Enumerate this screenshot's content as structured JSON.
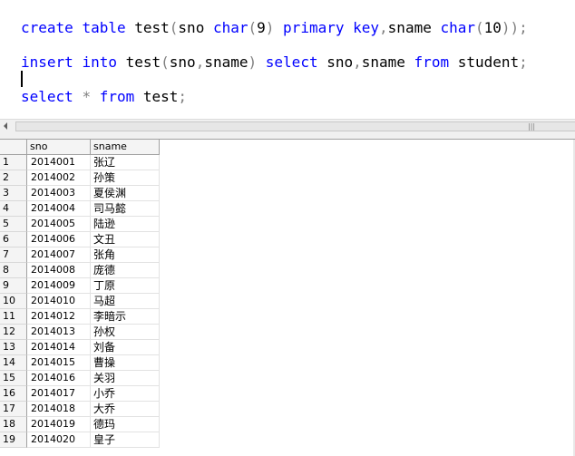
{
  "editor": {
    "line1": [
      {
        "t": "create",
        "k": "kw"
      },
      {
        "t": " ",
        "k": ""
      },
      {
        "t": "table",
        "k": "kw"
      },
      {
        "t": " test",
        "k": ""
      },
      {
        "t": "(",
        "k": "op"
      },
      {
        "t": "sno ",
        "k": ""
      },
      {
        "t": "char",
        "k": "kw"
      },
      {
        "t": "(",
        "k": "op"
      },
      {
        "t": "9",
        "k": ""
      },
      {
        "t": ")",
        "k": "op"
      },
      {
        "t": " ",
        "k": ""
      },
      {
        "t": "primary",
        "k": "kw"
      },
      {
        "t": " ",
        "k": ""
      },
      {
        "t": "key",
        "k": "kw"
      },
      {
        "t": ",",
        "k": "op"
      },
      {
        "t": "sname ",
        "k": ""
      },
      {
        "t": "char",
        "k": "kw"
      },
      {
        "t": "(",
        "k": "op"
      },
      {
        "t": "10",
        "k": ""
      },
      {
        "t": "));",
        "k": "op"
      }
    ],
    "line2": [
      {
        "t": "insert",
        "k": "kw"
      },
      {
        "t": " ",
        "k": ""
      },
      {
        "t": "into",
        "k": "kw"
      },
      {
        "t": " test",
        "k": ""
      },
      {
        "t": "(",
        "k": "op"
      },
      {
        "t": "sno",
        "k": ""
      },
      {
        "t": ",",
        "k": "op"
      },
      {
        "t": "sname",
        "k": ""
      },
      {
        "t": ")",
        "k": "op"
      },
      {
        "t": " ",
        "k": ""
      },
      {
        "t": "select",
        "k": "kw"
      },
      {
        "t": " sno",
        "k": ""
      },
      {
        "t": ",",
        "k": "op"
      },
      {
        "t": "sname ",
        "k": ""
      },
      {
        "t": "from",
        "k": "kw"
      },
      {
        "t": " student",
        "k": ""
      },
      {
        "t": ";",
        "k": "op"
      }
    ],
    "line3": [
      {
        "t": "select",
        "k": "kw"
      },
      {
        "t": " ",
        "k": ""
      },
      {
        "t": "*",
        "k": "op"
      },
      {
        "t": " ",
        "k": ""
      },
      {
        "t": "from",
        "k": "kw"
      },
      {
        "t": " test",
        "k": ""
      },
      {
        "t": ";",
        "k": "op"
      }
    ]
  },
  "scrollbar": {
    "grip": "|||"
  },
  "results": {
    "columns": [
      "sno",
      "sname"
    ],
    "rows": [
      {
        "n": "1",
        "sno": "2014001",
        "sname": "张辽"
      },
      {
        "n": "2",
        "sno": "2014002",
        "sname": "孙策"
      },
      {
        "n": "3",
        "sno": "2014003",
        "sname": "夏侯渊"
      },
      {
        "n": "4",
        "sno": "2014004",
        "sname": "司马懿"
      },
      {
        "n": "5",
        "sno": "2014005",
        "sname": "陆逊"
      },
      {
        "n": "6",
        "sno": "2014006",
        "sname": "文丑"
      },
      {
        "n": "7",
        "sno": "2014007",
        "sname": "张角"
      },
      {
        "n": "8",
        "sno": "2014008",
        "sname": "庞德"
      },
      {
        "n": "9",
        "sno": "2014009",
        "sname": "丁原"
      },
      {
        "n": "10",
        "sno": "2014010",
        "sname": "马超"
      },
      {
        "n": "11",
        "sno": "2014012",
        "sname": "李暗示"
      },
      {
        "n": "12",
        "sno": "2014013",
        "sname": "孙权"
      },
      {
        "n": "13",
        "sno": "2014014",
        "sname": "刘备"
      },
      {
        "n": "14",
        "sno": "2014015",
        "sname": "曹操"
      },
      {
        "n": "15",
        "sno": "2014016",
        "sname": "关羽"
      },
      {
        "n": "16",
        "sno": "2014017",
        "sname": "小乔"
      },
      {
        "n": "17",
        "sno": "2014018",
        "sname": "大乔"
      },
      {
        "n": "18",
        "sno": "2014019",
        "sname": "德玛"
      },
      {
        "n": "19",
        "sno": "2014020",
        "sname": "皇子"
      }
    ]
  },
  "colors": {
    "keyword": "#0000ff",
    "operator": "#808080",
    "text": "#000000"
  }
}
